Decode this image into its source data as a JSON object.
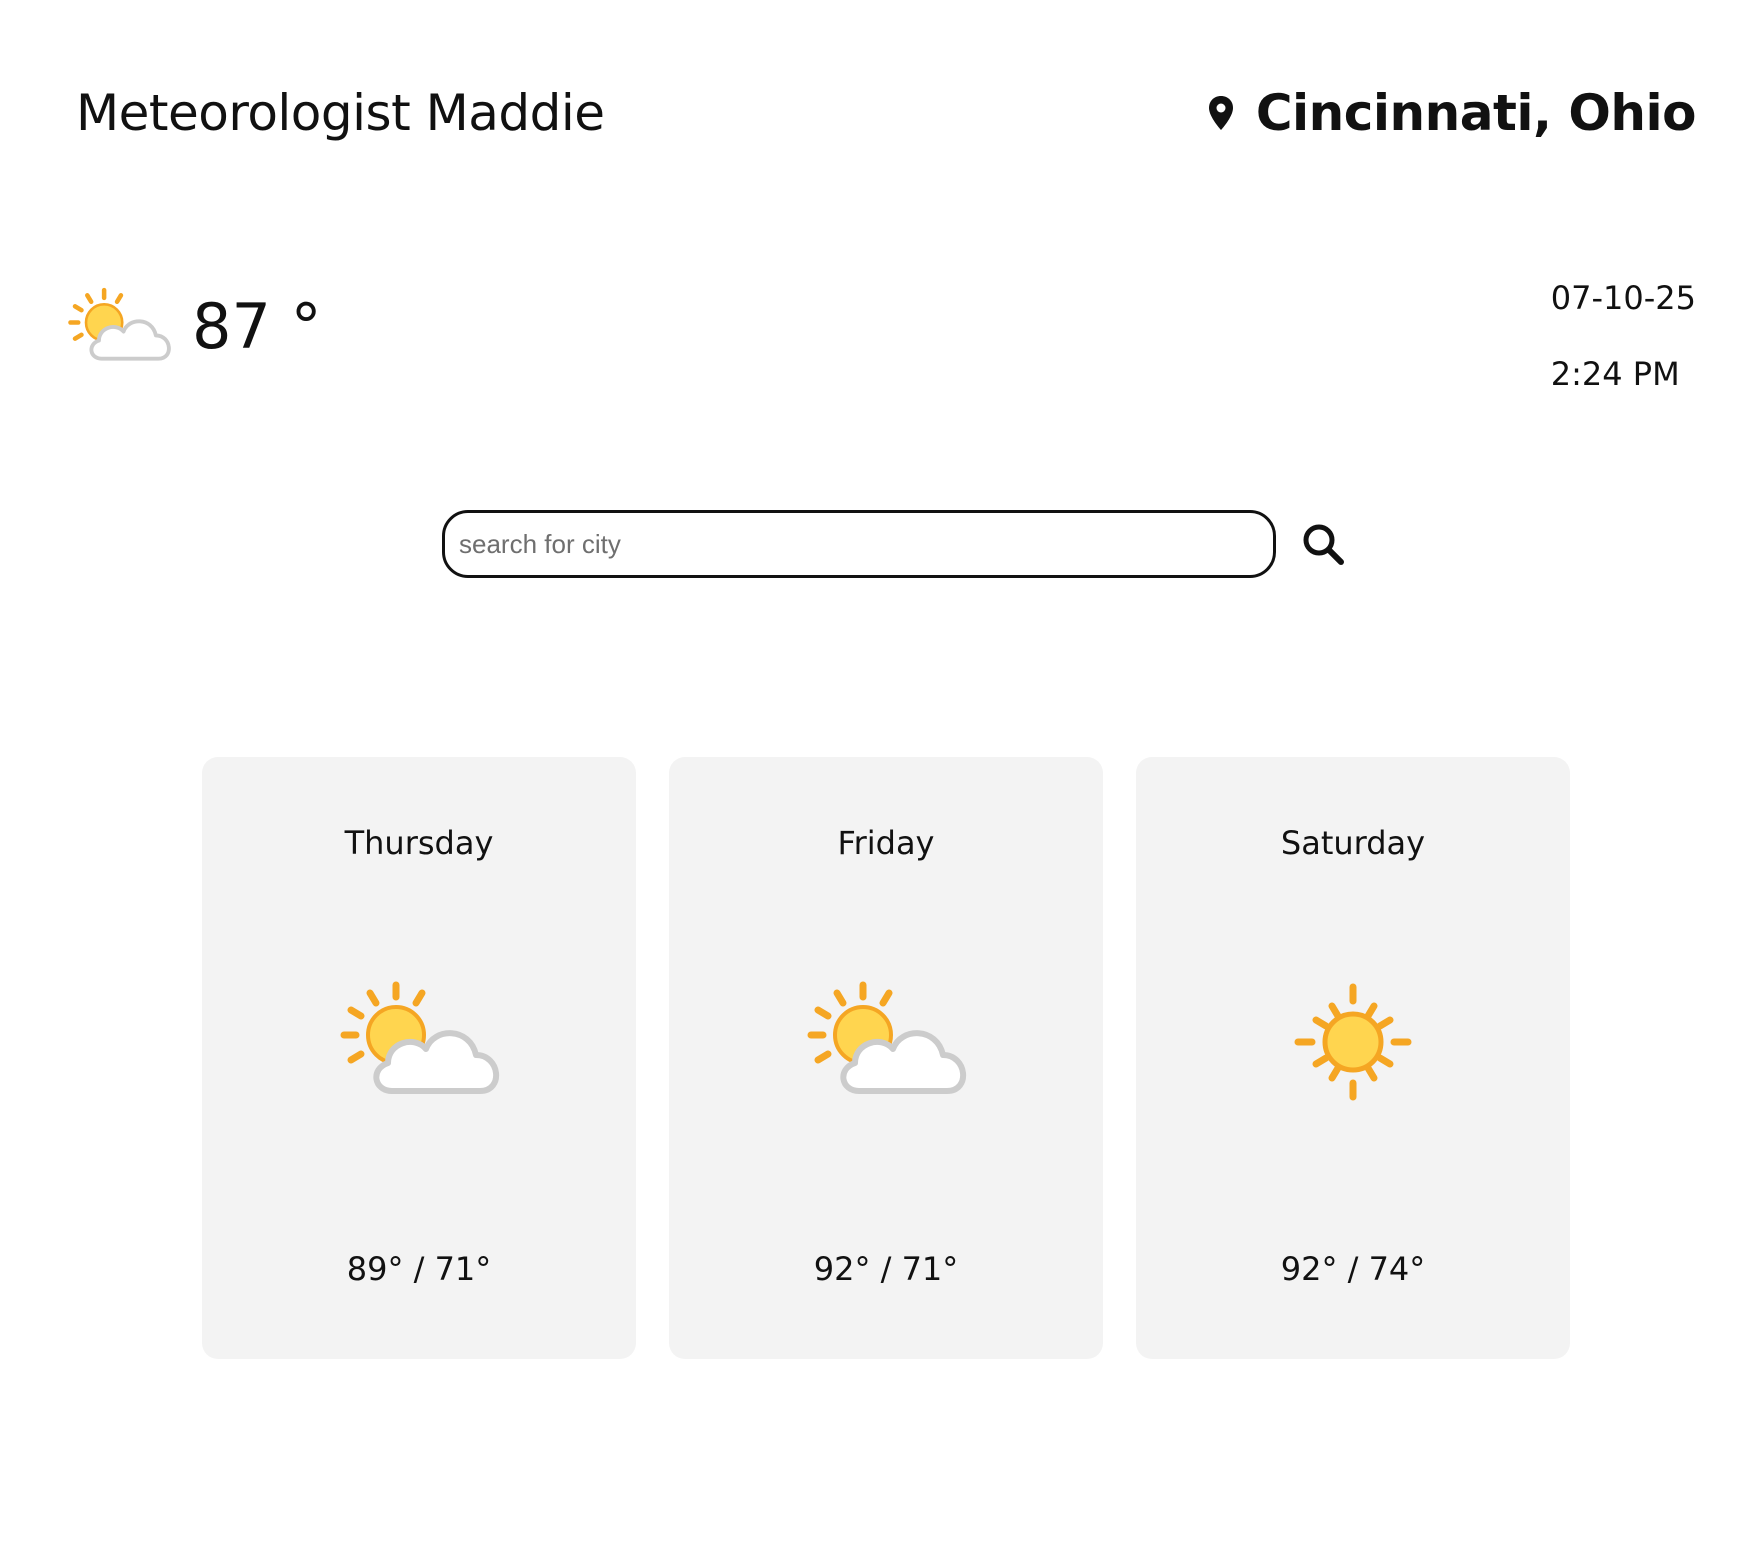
{
  "header": {
    "title": "Meteorologist Maddie",
    "location": "Cincinnati, Ohio",
    "location_icon": "map-pin-icon"
  },
  "current": {
    "temperature": "87 °",
    "condition_icon": "partly-cloudy-icon",
    "date": "07-10-25",
    "time": "2:24 PM"
  },
  "search": {
    "placeholder": "search for city",
    "value": "",
    "button_icon": "search-icon"
  },
  "forecast": [
    {
      "day": "Thursday",
      "temps": "89° / 71°",
      "icon": "partly-cloudy-icon"
    },
    {
      "day": "Friday",
      "temps": "92° / 71°",
      "icon": "partly-cloudy-icon"
    },
    {
      "day": "Saturday",
      "temps": "92° / 74°",
      "icon": "sunny-icon"
    }
  ],
  "colors": {
    "sun_fill": "#FFD54F",
    "sun_rays": "#F5A623",
    "cloud_fill": "#FFFFFF",
    "cloud_outline": "#CCCCCC",
    "card_background": "#F3F3F3",
    "text": "#111111"
  }
}
